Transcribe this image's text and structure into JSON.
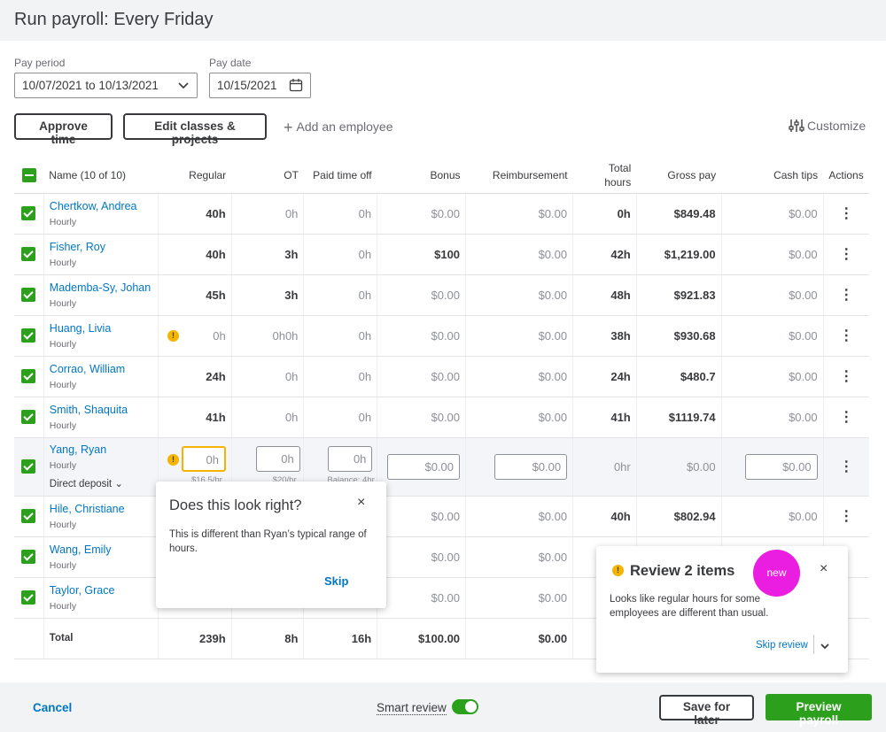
{
  "page": {
    "title": "Run payroll: Every Friday"
  },
  "pay_period": {
    "label": "Pay period",
    "value": "10/07/2021 to 10/13/2021"
  },
  "pay_date": {
    "label": "Pay date",
    "value": "10/15/2021"
  },
  "toolbar": {
    "approve_time": "Approve time",
    "edit_classes": "Edit classes & projects",
    "add_employee": "Add an employee",
    "customize": "Customize"
  },
  "columns": {
    "name": "Name (10 of 10)",
    "regular": "Regular",
    "ot": "OT",
    "pto": "Paid time off",
    "bonus": "Bonus",
    "reimbursement": "Reimbursement",
    "total_hours_1": "Total",
    "total_hours_2": "hours",
    "gross_pay": "Gross pay",
    "cash_tips": "Cash tips",
    "actions": "Actions"
  },
  "rows": [
    {
      "name": "Chertkow, Andrea",
      "type": "Hourly",
      "regular": "40h",
      "ot": "0h",
      "pto": "0h",
      "bonus": "$0.00",
      "reimb": "$0.00",
      "total": "0h",
      "gross": "$849.48",
      "tips": "$0.00"
    },
    {
      "name": "Fisher, Roy",
      "type": "Hourly",
      "regular": "40h",
      "ot": "3h",
      "pto": "0h",
      "bonus": "$100",
      "reimb": "$0.00",
      "total": "42h",
      "gross": "$1,219.00",
      "tips": "$0.00"
    },
    {
      "name": "Mademba-Sy, Johan",
      "type": "Hourly",
      "regular": "45h",
      "ot": "3h",
      "pto": "0h",
      "bonus": "$0.00",
      "reimb": "$0.00",
      "total": "48h",
      "gross": "$921.83",
      "tips": "$0.00"
    },
    {
      "name": "Huang, Livia",
      "type": "Hourly",
      "regular": "0h",
      "ot": "0h0h",
      "pto": "0h",
      "bonus": "$0.00",
      "reimb": "$0.00",
      "total": "38h",
      "gross": "$930.68",
      "tips": "$0.00",
      "warn": "!"
    },
    {
      "name": "Corrao, William",
      "type": "Hourly",
      "regular": "24h",
      "ot": "0h",
      "pto": "0h",
      "bonus": "$0.00",
      "reimb": "$0.00",
      "total": "24h",
      "gross": "$480.7",
      "tips": "$0.00"
    },
    {
      "name": "Smith, Shaquita",
      "type": "Hourly",
      "regular": "41h",
      "ot": "0h",
      "pto": "0h",
      "bonus": "$0.00",
      "reimb": "$0.00",
      "total": "41h",
      "gross": "$1119.74",
      "tips": "$0.00"
    },
    {
      "name": "Yang, Ryan",
      "type": "Hourly",
      "payment": "Direct deposit",
      "regular": "0h",
      "ot": "0h",
      "pto": "0h",
      "bonus": "$0.00",
      "reimb": "$0.00",
      "total": "0hr",
      "gross": "$0.00",
      "tips": "$0.00",
      "rate_regular": "$16.5/hr",
      "rate_ot": "$20/hr",
      "balance": "Balance: 4hr",
      "warn": "!"
    },
    {
      "name": "Hile, Christiane",
      "type": "Hourly",
      "regular": "",
      "ot": "",
      "pto": "",
      "bonus": "$0.00",
      "reimb": "$0.00",
      "total": "40h",
      "gross": "$802.94",
      "tips": "$0.00"
    },
    {
      "name": "Wang, Emily",
      "type": "Hourly",
      "regular": "",
      "ot": "",
      "pto": "",
      "bonus": "$0.00",
      "reimb": "$0.00",
      "total": "",
      "gross": "",
      "tips": ""
    },
    {
      "name": "Taylor, Grace",
      "type": "Hourly",
      "regular": "",
      "ot": "",
      "pto": "",
      "bonus": "$0.00",
      "reimb": "$0.00",
      "total": "",
      "gross": "",
      "tips": ""
    }
  ],
  "totals": {
    "label": "Total",
    "regular": "239h",
    "ot": "8h",
    "pto": "16h",
    "bonus": "$100.00",
    "reimb": "$0.00"
  },
  "popover": {
    "title": "Does this look right?",
    "body": "This is different than Ryan’s typical range of hours.",
    "skip": "Skip",
    "close": "×"
  },
  "review": {
    "title": "Review 2 items",
    "badge": "new",
    "body": "Looks like regular hours for some employees are different than usual.",
    "skip": "Skip review",
    "close": "×",
    "warn": "!"
  },
  "footer": {
    "cancel": "Cancel",
    "smart_review": "Smart review",
    "save_later": "Save for later",
    "preview": "Preview payroll"
  },
  "colors": {
    "brand_green": "#2ca01c",
    "link_blue": "#0077c5",
    "warning": "#f4b400",
    "new_badge": "#e91ee1"
  }
}
